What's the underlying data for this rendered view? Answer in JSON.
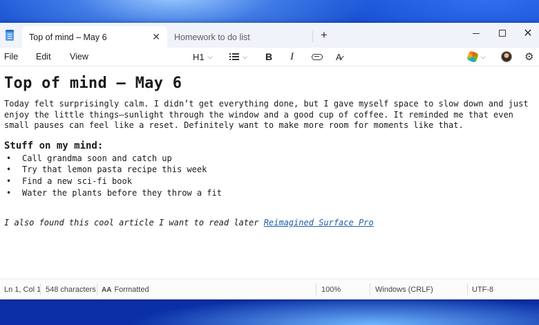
{
  "tabs": [
    {
      "label": "Top of mind – May 6",
      "active": true
    },
    {
      "label": "Homework to do list",
      "active": false
    }
  ],
  "window_controls": {
    "new_tab": "+",
    "close": "✕"
  },
  "menu": {
    "file": "File",
    "edit": "Edit",
    "view": "View"
  },
  "toolbar": {
    "heading": "H1",
    "heading_caret": "⌵",
    "list_caret": "⌵",
    "bold": "B",
    "italic": "I",
    "clear_format": "A̷",
    "copilot_caret": "⌵",
    "settings": "⚙"
  },
  "document": {
    "title": "Top of mind – May 6",
    "paragraph": "Today felt surprisingly calm. I didn’t get everything done, but I gave myself space to slow down and just enjoy the little things—sunlight through the window and a good cup of coffee. It reminded me that even small pauses can feel like a reset. Definitely want to make more room for moments like that.",
    "subheading": "Stuff on my mind:",
    "items": [
      "Call grandma soon and catch up",
      "Try that lemon pasta recipe this week",
      "Find a new sci-fi book",
      "Water the plants before they throw a fit"
    ],
    "article_text": "I also found this cool article I want to read later ",
    "article_link": "Reimagined Surface Pro"
  },
  "status": {
    "position": "Ln 1, Col 1",
    "characters": "548 characters",
    "format_icon": "AA",
    "format": "Formatted",
    "zoom": "100%",
    "line_ending": "Windows (CRLF)",
    "encoding": "UTF-8"
  },
  "colors": {
    "link": "#1f5eaa",
    "titlebar": "#f0f3f9",
    "wallpaper": "#0b3bb0"
  }
}
